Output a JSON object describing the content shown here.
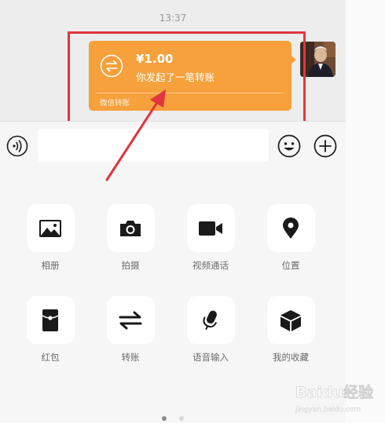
{
  "chat": {
    "timestamp": "13:37",
    "transfer": {
      "amount": "¥1.00",
      "description": "你发起了一笔转账",
      "footer": "微信转账",
      "icon": "transfer-arrows-icon"
    }
  },
  "input_bar": {
    "voice_icon": "voice-icon",
    "input_value": "",
    "emoji_icon": "emoji-icon",
    "plus_icon": "plus-icon"
  },
  "panel": {
    "items": [
      {
        "label": "相册",
        "icon": "photo-icon"
      },
      {
        "label": "拍摄",
        "icon": "camera-icon"
      },
      {
        "label": "视频通话",
        "icon": "video-call-icon"
      },
      {
        "label": "位置",
        "icon": "location-pin-icon"
      },
      {
        "label": "红包",
        "icon": "red-packet-icon"
      },
      {
        "label": "转账",
        "icon": "transfer-icon"
      },
      {
        "label": "语音输入",
        "icon": "microphone-icon"
      },
      {
        "label": "我的收藏",
        "icon": "favorites-cube-icon"
      }
    ],
    "page_indicator": {
      "current": 1,
      "total": 2
    }
  },
  "watermark": {
    "text": "Baidu经验",
    "subtext": "jingyan.baidu.com"
  },
  "colors": {
    "transfer_bubble": "#f6a13c",
    "highlight": "#e2353d",
    "screen_bg": "#ededed",
    "panel_bg": "#f6f6f6"
  }
}
